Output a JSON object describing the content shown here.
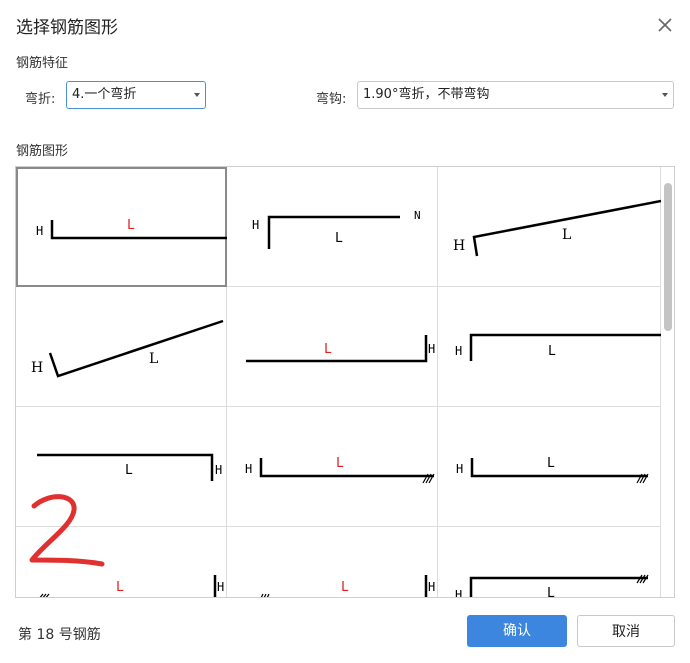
{
  "dialog": {
    "title": "选择钢筋图形",
    "close_icon": "close-icon"
  },
  "features": {
    "section_label": "钢筋特征",
    "bend_label": "弯折:",
    "bend_value": "4.一个弯折",
    "hook_label": "弯钩:",
    "hook_value": "1.90°弯折，不带弯钩"
  },
  "shapes": {
    "section_label": "钢筋图形",
    "cells": [
      {
        "labels": [
          "H",
          "L"
        ],
        "selected": true
      },
      {
        "labels": [
          "H",
          "L",
          "N"
        ]
      },
      {
        "labels": [
          "H",
          "L"
        ]
      },
      {
        "labels": [
          "H",
          "L"
        ]
      },
      {
        "labels": [
          "L",
          "H"
        ]
      },
      {
        "labels": [
          "H",
          "L"
        ]
      },
      {
        "labels": [
          "L",
          "H"
        ]
      },
      {
        "labels": [
          "H",
          "L"
        ]
      },
      {
        "labels": [
          "H",
          "L"
        ]
      },
      {
        "labels": [
          "L",
          "H"
        ]
      },
      {
        "labels": [
          "L",
          "H"
        ]
      },
      {
        "labels": [
          "H",
          "L"
        ]
      }
    ],
    "annotation": "2"
  },
  "footer": {
    "status": "第 18 号钢筋",
    "confirm": "确认",
    "cancel": "取消"
  },
  "colors": {
    "accent": "#3d86e0",
    "label_red": "#e02020",
    "annotation_red": "#e03030"
  }
}
